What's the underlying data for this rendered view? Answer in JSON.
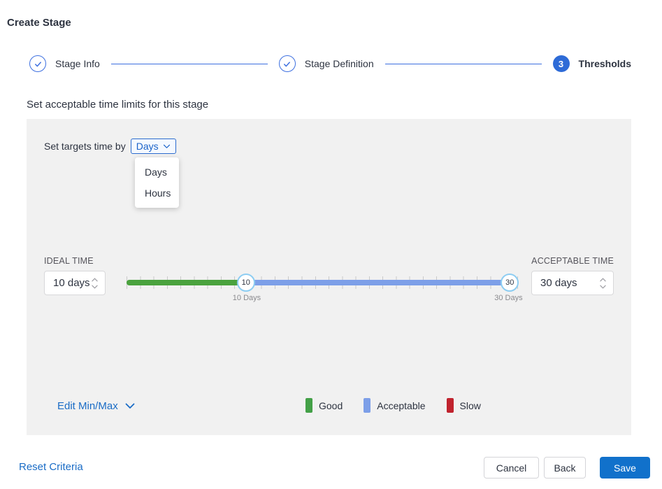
{
  "window_title": "Create Stage",
  "stepper": {
    "steps": [
      {
        "label": "Stage Info",
        "state": "complete"
      },
      {
        "label": "Stage Definition",
        "state": "complete"
      },
      {
        "label": "Thresholds",
        "number": "3",
        "state": "current"
      }
    ]
  },
  "section_heading": "Set acceptable time limits for this stage",
  "targets": {
    "label": "Set targets time by",
    "selected": "Days",
    "dropdown_options": [
      "Days",
      "Hours"
    ]
  },
  "ideal_time": {
    "label": "IDEAL TIME",
    "value": "10 days"
  },
  "acceptable_time": {
    "label": "ACCEPTABLE TIME",
    "value": "30 days"
  },
  "slider": {
    "min_handle_value": "10",
    "max_handle_value": "30",
    "min_handle_caption": "10 Days",
    "max_handle_caption": "30 Days",
    "segments": [
      {
        "name": "good",
        "color": "#4aa23e"
      },
      {
        "name": "acceptable",
        "color": "#7d9fe8"
      }
    ]
  },
  "edit_minmax_label": "Edit Min/Max",
  "legend": [
    {
      "label": "Good",
      "color": "#43a047"
    },
    {
      "label": "Acceptable",
      "color": "#7d9fe8"
    },
    {
      "label": "Slow",
      "color": "#c0232e"
    }
  ],
  "footer": {
    "reset": "Reset Criteria",
    "cancel": "Cancel",
    "back": "Back",
    "save": "Save"
  },
  "colors": {
    "primary_button_blue": "#1171cb",
    "link_blue": "#1a6cc6",
    "stepper_blue": "#3c6fe0",
    "dropdown_blue": "#1b63c9",
    "panel_background": "#f1f1f1",
    "handle_border_blue": "#8dcdf2"
  }
}
